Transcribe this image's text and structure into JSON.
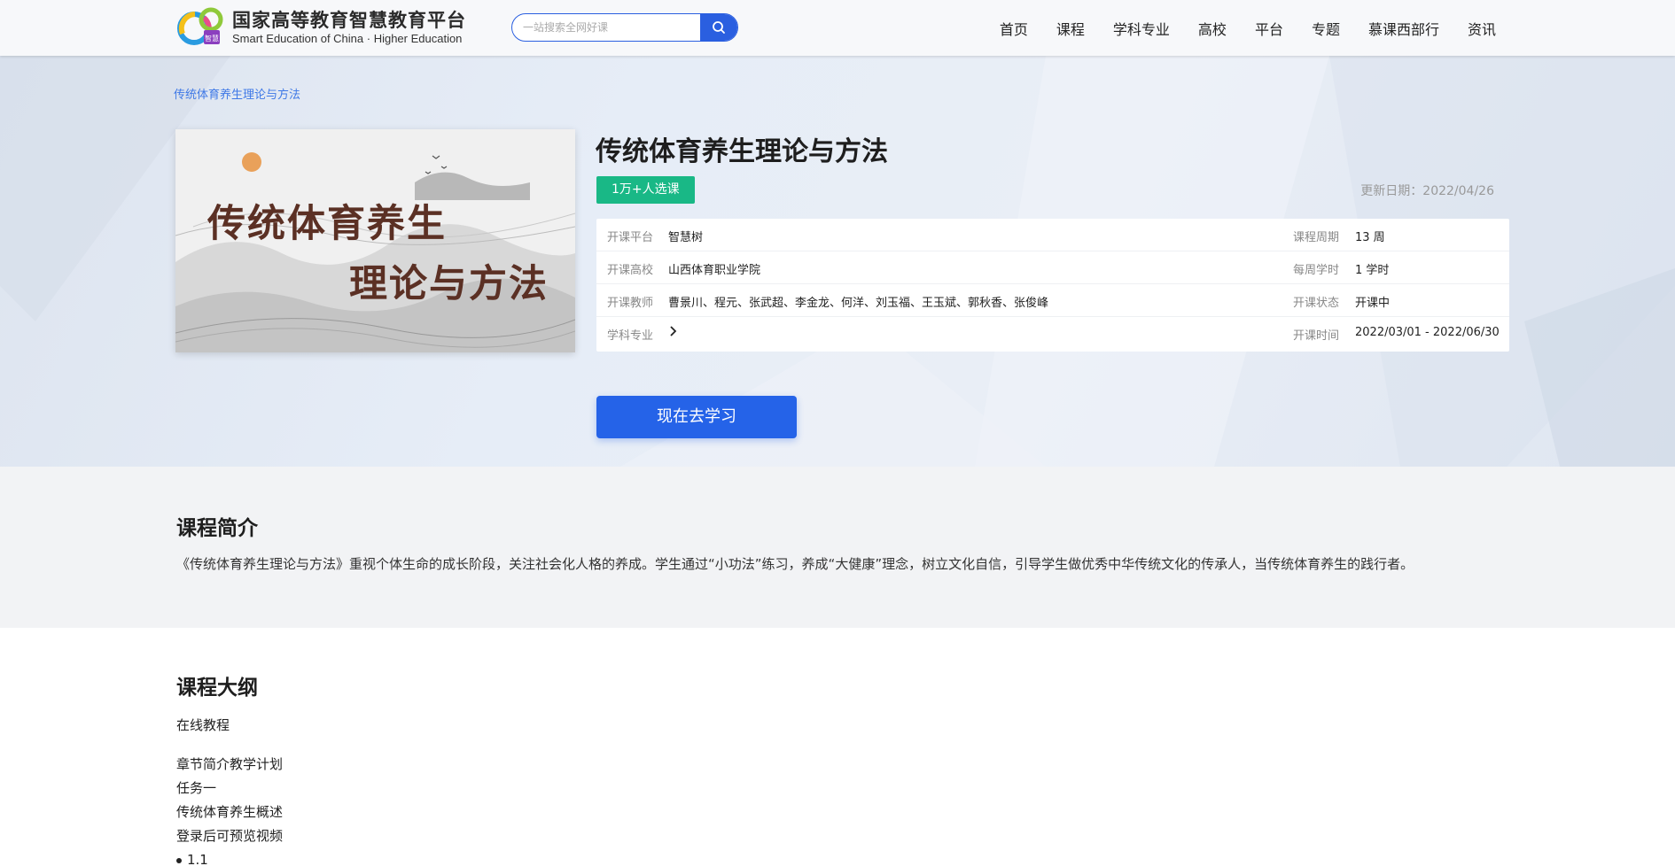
{
  "header": {
    "logo_cn": "国家高等教育智慧教育平台",
    "logo_en": "Smart Education of China · Higher Education",
    "search_placeholder": "一站搜索全网好课",
    "nav": [
      "首页",
      "课程",
      "学科专业",
      "高校",
      "平台",
      "专题",
      "慕课西部行",
      "资讯"
    ]
  },
  "hero": {
    "breadcrumb": "传统体育养生理论与方法",
    "cover_line1": "传统体育养生",
    "cover_line2": "理论与方法",
    "title": "传统体育养生理论与方法",
    "enroll_badge": "1万+人选课",
    "update_date": "更新日期：2022/04/26",
    "info": {
      "platform_label": "开课平台",
      "platform": "智慧树",
      "cycle_label": "课程周期",
      "cycle": "13 周",
      "school_label": "开课高校",
      "school": "山西体育职业学院",
      "weekly_label": "每周学时",
      "weekly": "1 学时",
      "teachers_label": "开课教师",
      "teachers": "曹景川、程元、张武超、李金龙、何洋、刘玉福、王玉斌、郭秋香、张俊峰",
      "status_label": "开课状态",
      "status": "开课中",
      "subject_label": "学科专业",
      "time_label": "开课时间",
      "time": "2022/03/01 - 2022/06/30"
    },
    "study_button": "现在去学习"
  },
  "intro": {
    "title": "课程简介",
    "text": "《传统体育养生理论与方法》重视个体生命的成长阶段，关注社会化人格的养成。学生通过“小功法”练习，养成“大健康”理念，树立文化自信，引导学生做优秀中华传统文化的传承人，当传统体育养生的践行者。"
  },
  "outline": {
    "title": "课程大纲",
    "subtitle": "在线教程",
    "items": [
      "章节简介教学计划",
      "任务一",
      "传统体育养生概述",
      "登录后可预览视频",
      "1.1"
    ]
  },
  "colors": {
    "primary": "#2563e8",
    "badge_green": "#19b886",
    "link_blue": "#3e78e6"
  }
}
